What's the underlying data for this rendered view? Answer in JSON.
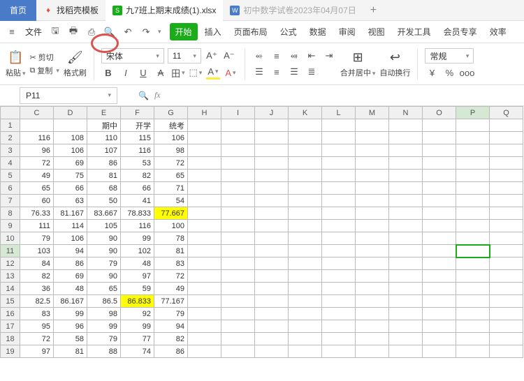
{
  "tabs": {
    "home": "首页",
    "t1": "找稻壳模板",
    "t2": "九7班上期末成绩(1).xlsx",
    "t3": "初中数学试卷2023年04月07日",
    "add": "+"
  },
  "qat": {
    "menu": "文件",
    "ribbon": [
      "开始",
      "插入",
      "页面布局",
      "公式",
      "数据",
      "审阅",
      "视图",
      "开发工具",
      "会员专享",
      "效率"
    ]
  },
  "clipboard": {
    "paste": "粘贴",
    "cut": "剪切",
    "copy": "复制",
    "format": "格式刷"
  },
  "font": {
    "name": "宋体",
    "size": "11"
  },
  "align": {
    "merge": "合并居中",
    "wrap": "自动换行"
  },
  "num": {
    "general": "常规",
    "cur": "¥",
    "pct": "%"
  },
  "namebox": {
    "value": "P11",
    "fx": "fx"
  },
  "cols": [
    "C",
    "D",
    "E",
    "F",
    "G",
    "H",
    "I",
    "J",
    "K",
    "L",
    "M",
    "N",
    "O",
    "P",
    "Q"
  ],
  "headers": {
    "E": "期中",
    "F": "开学",
    "G": "统考"
  },
  "rows": [
    {
      "n": 1
    },
    {
      "n": 2,
      "c": [
        116,
        108,
        110,
        115,
        106
      ]
    },
    {
      "n": 3,
      "c": [
        96,
        106,
        107,
        116,
        98
      ]
    },
    {
      "n": 4,
      "c": [
        72,
        69,
        86,
        53,
        72
      ]
    },
    {
      "n": 5,
      "c": [
        49,
        75,
        81,
        82,
        65
      ]
    },
    {
      "n": 6,
      "c": [
        65,
        66,
        68,
        66,
        71
      ]
    },
    {
      "n": 7,
      "c": [
        60,
        63,
        50,
        41,
        54
      ]
    },
    {
      "n": 8,
      "c": [
        "76.33",
        "81.167",
        "83.667",
        "78.833",
        "77.667"
      ],
      "hlG": true
    },
    {
      "n": 9,
      "c": [
        111,
        114,
        105,
        116,
        100
      ]
    },
    {
      "n": 10,
      "c": [
        79,
        106,
        90,
        99,
        78
      ]
    },
    {
      "n": 11,
      "c": [
        103,
        94,
        90,
        102,
        81
      ],
      "sel": true
    },
    {
      "n": 12,
      "c": [
        84,
        86,
        79,
        48,
        83
      ]
    },
    {
      "n": 13,
      "c": [
        82,
        69,
        90,
        97,
        72
      ]
    },
    {
      "n": 14,
      "c": [
        36,
        48,
        65,
        59,
        49
      ]
    },
    {
      "n": 15,
      "c": [
        "82.5",
        "86.167",
        "86.5",
        "86.833",
        "77.167"
      ],
      "hlF": true
    },
    {
      "n": 16,
      "c": [
        83,
        99,
        98,
        92,
        79
      ]
    },
    {
      "n": 17,
      "c": [
        95,
        96,
        99,
        99,
        94
      ]
    },
    {
      "n": 18,
      "c": [
        72,
        58,
        79,
        77,
        82
      ]
    },
    {
      "n": 19,
      "c": [
        97,
        81,
        88,
        74,
        86
      ]
    }
  ],
  "selected_col": "P"
}
